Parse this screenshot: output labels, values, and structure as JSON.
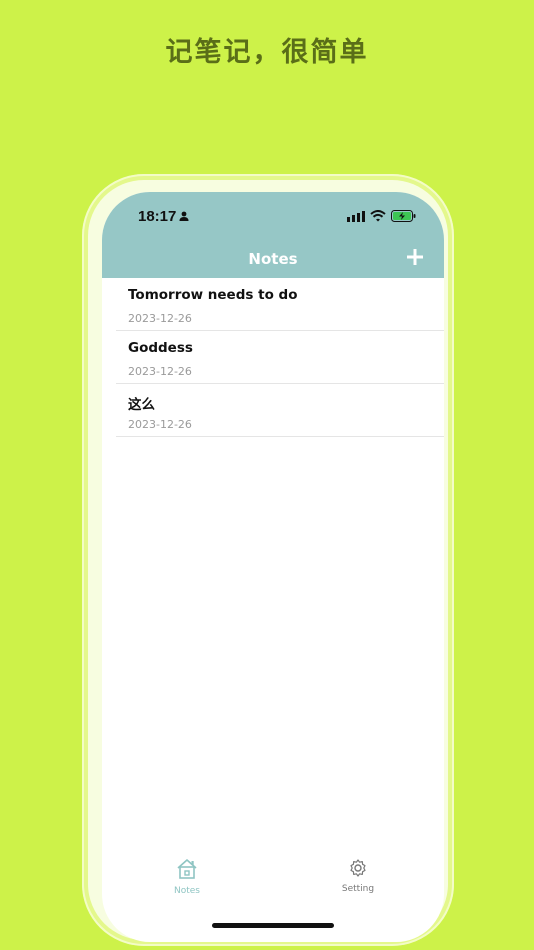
{
  "promo": {
    "headline": "记笔记，很简单"
  },
  "status_bar": {
    "time": "18:17"
  },
  "header": {
    "title": "Notes"
  },
  "notes": [
    {
      "title": "Tomorrow needs to do",
      "date": "2023-12-26"
    },
    {
      "title": "Goddess",
      "date": "2023-12-26"
    },
    {
      "title": "这么",
      "date": "2023-12-26"
    }
  ],
  "tabbar": {
    "items": [
      {
        "label": "Notes",
        "icon": "home-icon",
        "active": true
      },
      {
        "label": "Setting",
        "icon": "gear-icon",
        "active": false
      }
    ]
  },
  "colors": {
    "background": "#cdf249",
    "header": "#96c7c6",
    "active_tab": "#8fc5c3",
    "headline": "#5a6e18"
  }
}
